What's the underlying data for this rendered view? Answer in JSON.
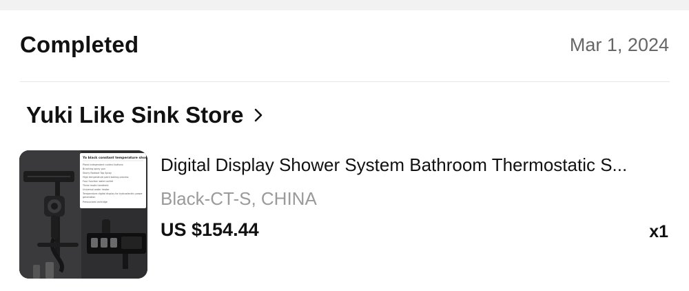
{
  "order": {
    "status": "Completed",
    "date": "Mar 1, 2024"
  },
  "store": {
    "name": "Yuki Like Sink Store",
    "chevron_icon": "chevron-right-icon"
  },
  "item": {
    "title": "Digital Display Shower System Bathroom Thermostatic S...",
    "variant": "Black-CT-S, CHINA",
    "price": "US $154.44",
    "quantity": "x1",
    "image": {
      "icon": "shower-product-image",
      "header": "Ya black constant temperature shower",
      "features": [
        "Piano independent control buttons",
        "Brushing spray gun",
        "Starry Radiant Top Spray",
        "High temperature paint baking process",
        "Four function water outlet",
        "Three mode handheld",
        "Universal water heater",
        "Temperature digital display for hydroelectric power generation",
        "Pressurized cartridge"
      ]
    }
  },
  "colors": {
    "background": "#ffffff",
    "top_band": "#f2f2f2",
    "divider": "#e6e6e6",
    "muted_text": "#9a9a9a",
    "date_text": "#666666"
  }
}
